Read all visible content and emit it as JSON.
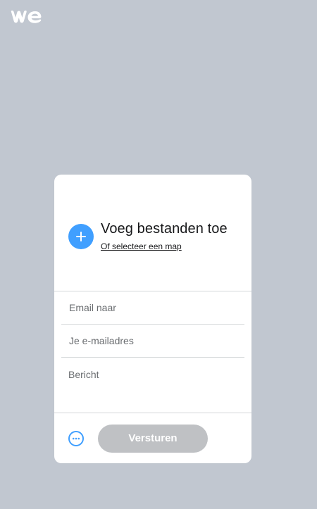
{
  "upload": {
    "title": "Voeg bestanden toe",
    "select_folder": "Of selecteer een map"
  },
  "form": {
    "email_to_placeholder": "Email naar",
    "your_email_placeholder": "Je e-mailadres",
    "message_placeholder": "Bericht"
  },
  "actions": {
    "send_label": "Versturen"
  },
  "icons": {
    "logo": "wetransfer-logo",
    "add": "plus-icon",
    "more": "more-options-icon"
  },
  "colors": {
    "background": "#c1c7d0",
    "accent": "#409fff",
    "button_disabled": "#bfc1c4"
  }
}
